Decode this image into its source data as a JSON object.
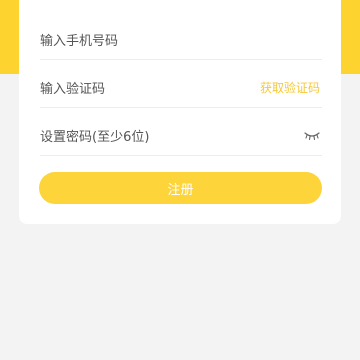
{
  "form": {
    "phone_placeholder": "输入手机号码",
    "code_placeholder": "输入验证码",
    "get_code_label": "获取验证码",
    "password_placeholder": "设置密码(至少6位)",
    "password_toggle_icon": "eye-closed-icon",
    "register_label": "注册"
  },
  "colors": {
    "accent": "#fdd32f",
    "link": "#f5c93a",
    "background": "#f3f3f3"
  }
}
